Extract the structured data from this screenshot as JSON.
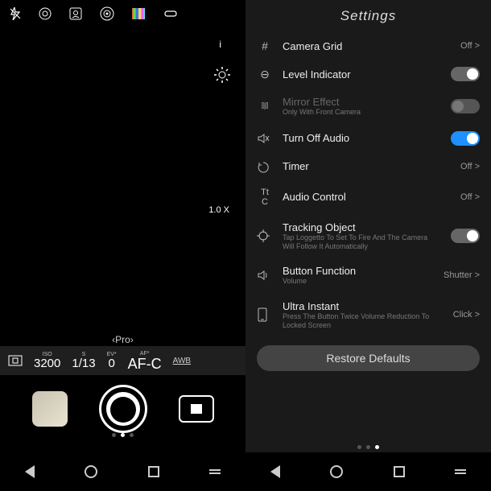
{
  "left": {
    "i": "i",
    "zoom": "1.0 X",
    "pro_label": "‹Pro›",
    "pro": {
      "iso_lbl": "ISO",
      "iso_val": "3200",
      "s_lbl": "S",
      "s_val": "1/13",
      "ev_lbl": "EV*",
      "ev_val": "0",
      "af_lbl": "AF*",
      "af_val": "AF-C",
      "awb": "AWB"
    }
  },
  "right": {
    "title": "Settings",
    "rows": {
      "grid": {
        "label": "Camera Grid",
        "ctrl": "Off >"
      },
      "level": {
        "label": "Level Indicator"
      },
      "mirror": {
        "label": "Mirror Effect",
        "sub": "Only With Front Camera"
      },
      "audio": {
        "label": "Turn Off Audio"
      },
      "timer": {
        "label": "Timer",
        "ctrl": "Off >"
      },
      "audioctrl": {
        "label": "Audio Control",
        "ctrl": "Off >"
      },
      "tracking": {
        "label": "Tracking Object",
        "sub": "Tap Loggetto To Set To Fire And The Camera Will Follow It Automatically"
      },
      "button": {
        "label": "Button Function",
        "sub": "Volume",
        "ctrl": "Shutter >"
      },
      "ultra": {
        "label": "Ultra Instant",
        "sub": "Press The Button Twice Volume Reduction To Locked Screen",
        "ctrl": "Click >"
      }
    },
    "abbr_icon": "Tt C",
    "grid_icon": "#",
    "level_icon": "⊖",
    "mirror_icon": "⫿|⫿",
    "restore": "Restore Defaults"
  }
}
